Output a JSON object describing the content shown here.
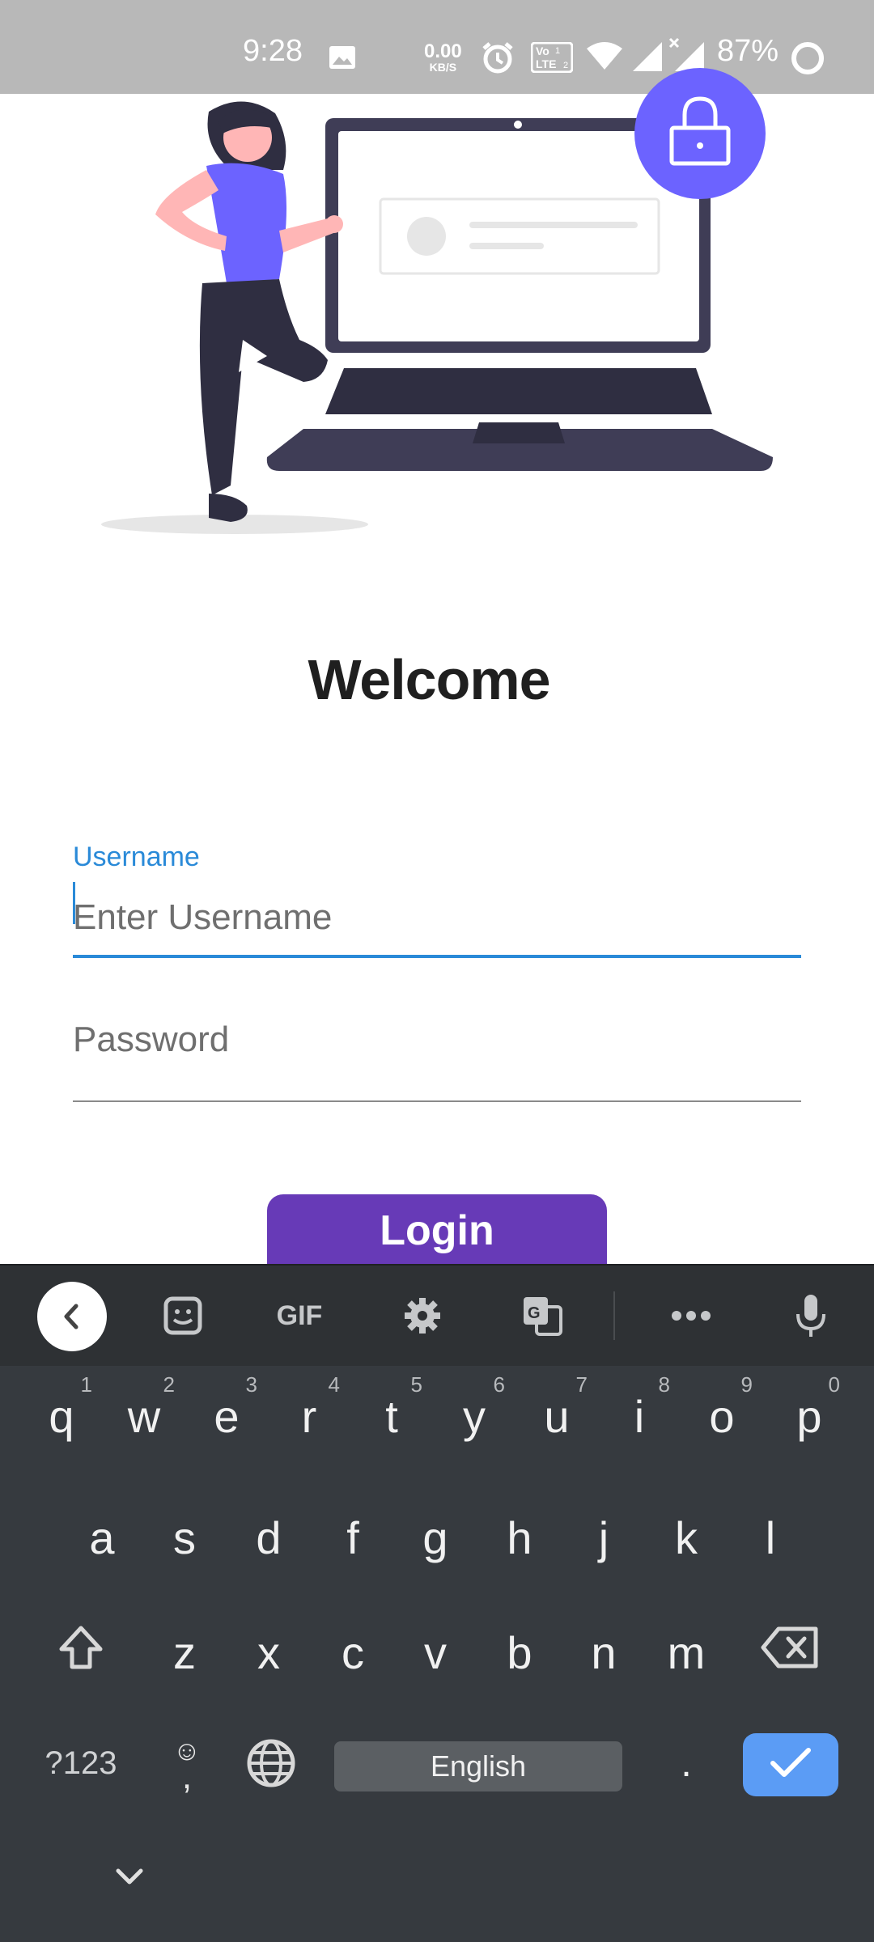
{
  "status_bar": {
    "time": "9:28",
    "net_speed_value": "0.00",
    "net_speed_unit": "KB/S",
    "volte_label_top": "Vo",
    "volte_label_bottom": "LTE",
    "sim_badge_1": "1",
    "sim_badge_2": "2",
    "battery_percent": "87%",
    "icons": [
      "image-icon",
      "alarm-icon",
      "volte-icon",
      "wifi-icon",
      "signal-icon",
      "signal-x-icon",
      "battery-ring-icon"
    ]
  },
  "illustration": {
    "name": "woman-with-laptop-login-illustration",
    "colors": {
      "accent": "#6c63ff",
      "dark": "#3f3d56",
      "figure": "#2f2e41",
      "skin": "#ffb6b6",
      "shadow": "#e6e6e6"
    },
    "lock_icon": "lock-icon"
  },
  "page": {
    "welcome_title": "Welcome"
  },
  "form": {
    "username_label": "Username",
    "username_placeholder": "Enter Username",
    "password_placeholder": "Password",
    "login_label": "Login",
    "accent_color": "#2a8ad8",
    "button_color": "#673ab7"
  },
  "keyboard": {
    "toolbar": {
      "back_icon": "chevron-left-icon",
      "sticker_icon": "sticker-icon",
      "gif_label": "GIF",
      "settings_icon": "gear-icon",
      "translate_icon": "translate-icon",
      "more_icon": "more-horizontal-icon",
      "mic_icon": "microphone-icon"
    },
    "row1": [
      {
        "k": "q",
        "hint": "1"
      },
      {
        "k": "w",
        "hint": "2"
      },
      {
        "k": "e",
        "hint": "3"
      },
      {
        "k": "r",
        "hint": "4"
      },
      {
        "k": "t",
        "hint": "5"
      },
      {
        "k": "y",
        "hint": "6"
      },
      {
        "k": "u",
        "hint": "7"
      },
      {
        "k": "i",
        "hint": "8"
      },
      {
        "k": "o",
        "hint": "9"
      },
      {
        "k": "p",
        "hint": "0"
      }
    ],
    "row2": [
      "a",
      "s",
      "d",
      "f",
      "g",
      "h",
      "j",
      "k",
      "l"
    ],
    "row3": [
      "z",
      "x",
      "c",
      "v",
      "b",
      "n",
      "m"
    ],
    "symbols_label": "?123",
    "emoji_label": "☺",
    "comma_label": ",",
    "space_label": "English",
    "period_label": ".",
    "enter_color": "#5b9cf5"
  }
}
